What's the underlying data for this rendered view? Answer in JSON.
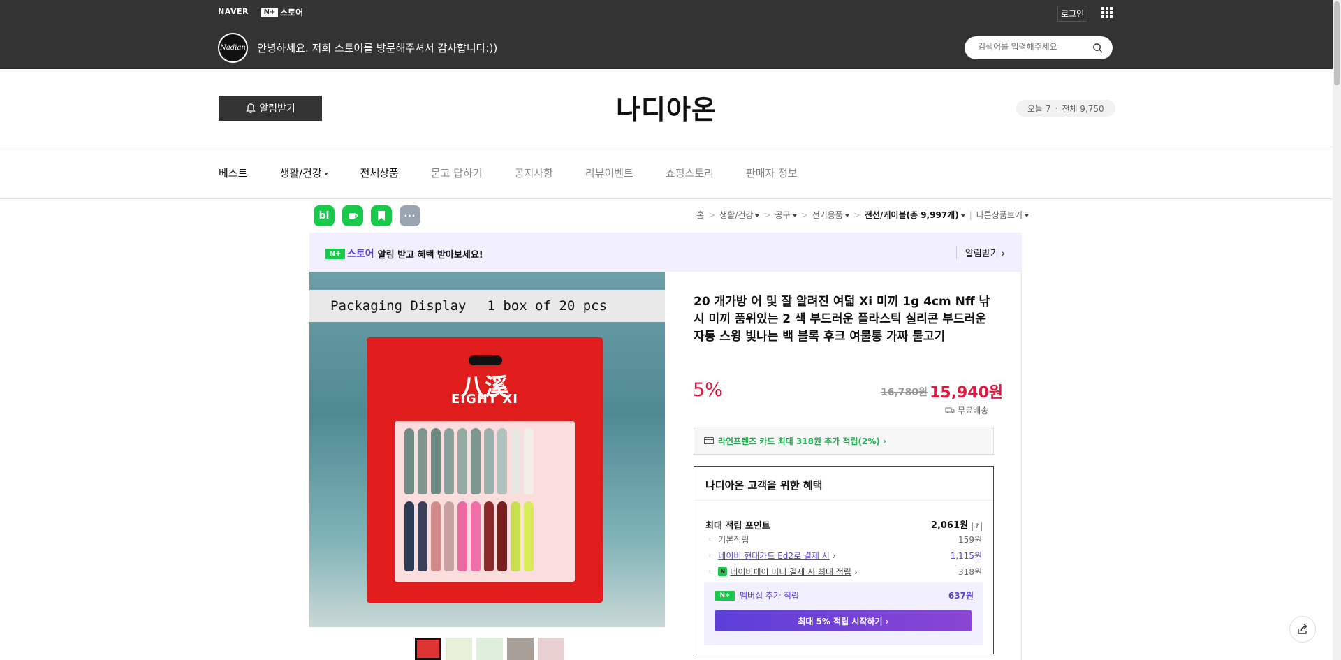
{
  "top": {
    "naver_label": "NAVER",
    "nplus_badge": "N+",
    "nplus_store_label": "스토어",
    "login_label": "로그인",
    "greeting": "안녕하세요. 저희 스토어를 방문해주셔서 감사합니다:))",
    "avatar_text": "Nadian",
    "search_placeholder": "검색어를 입력해주세요"
  },
  "store": {
    "alarm_label": "알림받기",
    "name": "나디아온",
    "today_label": "오늘 7",
    "total_label": "전체 9,750"
  },
  "nav": {
    "items": [
      {
        "label": "베스트"
      },
      {
        "label": "생활/건강"
      },
      {
        "label": "전체상품"
      },
      {
        "label": "묻고 답하기"
      },
      {
        "label": "공지사항"
      },
      {
        "label": "리뷰이벤트"
      },
      {
        "label": "쇼핑스토리"
      },
      {
        "label": "판매자 정보"
      }
    ]
  },
  "social": {
    "blog": "bl",
    "more": "···"
  },
  "breadcrumb": {
    "home": "홈",
    "cat1": "생활/건강",
    "cat2": "공구",
    "cat3": "전기용품",
    "current": "전선/케이블(총 9,997개)",
    "other": "다른상품보기"
  },
  "promo": {
    "badge": "N+",
    "store": "스토어",
    "text": "알림 받고 혜택 받아보세요!",
    "right": "알림받기 ›"
  },
  "image": {
    "banner_left": "Packaging Display",
    "banner_right": "1 box of 20 pcs",
    "brand_big": "八溪",
    "brand": "EIGHT XI"
  },
  "product": {
    "title": "20 개가방 어 및 잘 알려진 여덟 Xi 미끼 1g 4cm Nff 낚시 미끼 품위있는 2 색 부드러운 플라스틱 실리콘 부드러운 자동 스윙 빛나는 백 블록 후크 여물통 가짜 물고기",
    "discount": "5%",
    "original_price": "16,780원",
    "sale_price": "15,940원",
    "delivery": "무료배송",
    "card_benefit": "라인프렌즈 카드 최대 318원 추가 적립(2%) ›"
  },
  "benefit": {
    "title": "나디아온 고객을 위한 혜택",
    "max_label": "최대 적립 포인트",
    "max_value": "2,061원",
    "help": "?",
    "base_label": "기본적립",
    "base_value": "159원",
    "card_label": "네이버 현대카드 Ed2로 결제 시",
    "card_value": "1,115원",
    "npay_badge": "N",
    "npay_label": "네이버페이 머니 결제 시 최대 적립",
    "npay_value": "318원",
    "member_badge": "N+",
    "member_label": "멤버십 추가 적립",
    "member_value": "637원",
    "member_btn": "최대 5% 적립 시작하기 ›"
  },
  "colors": {
    "topbar": "#333333",
    "sale_red": "#e4183f",
    "naver_green": "#19c94b",
    "membership_purple": "#5b3fd9"
  }
}
